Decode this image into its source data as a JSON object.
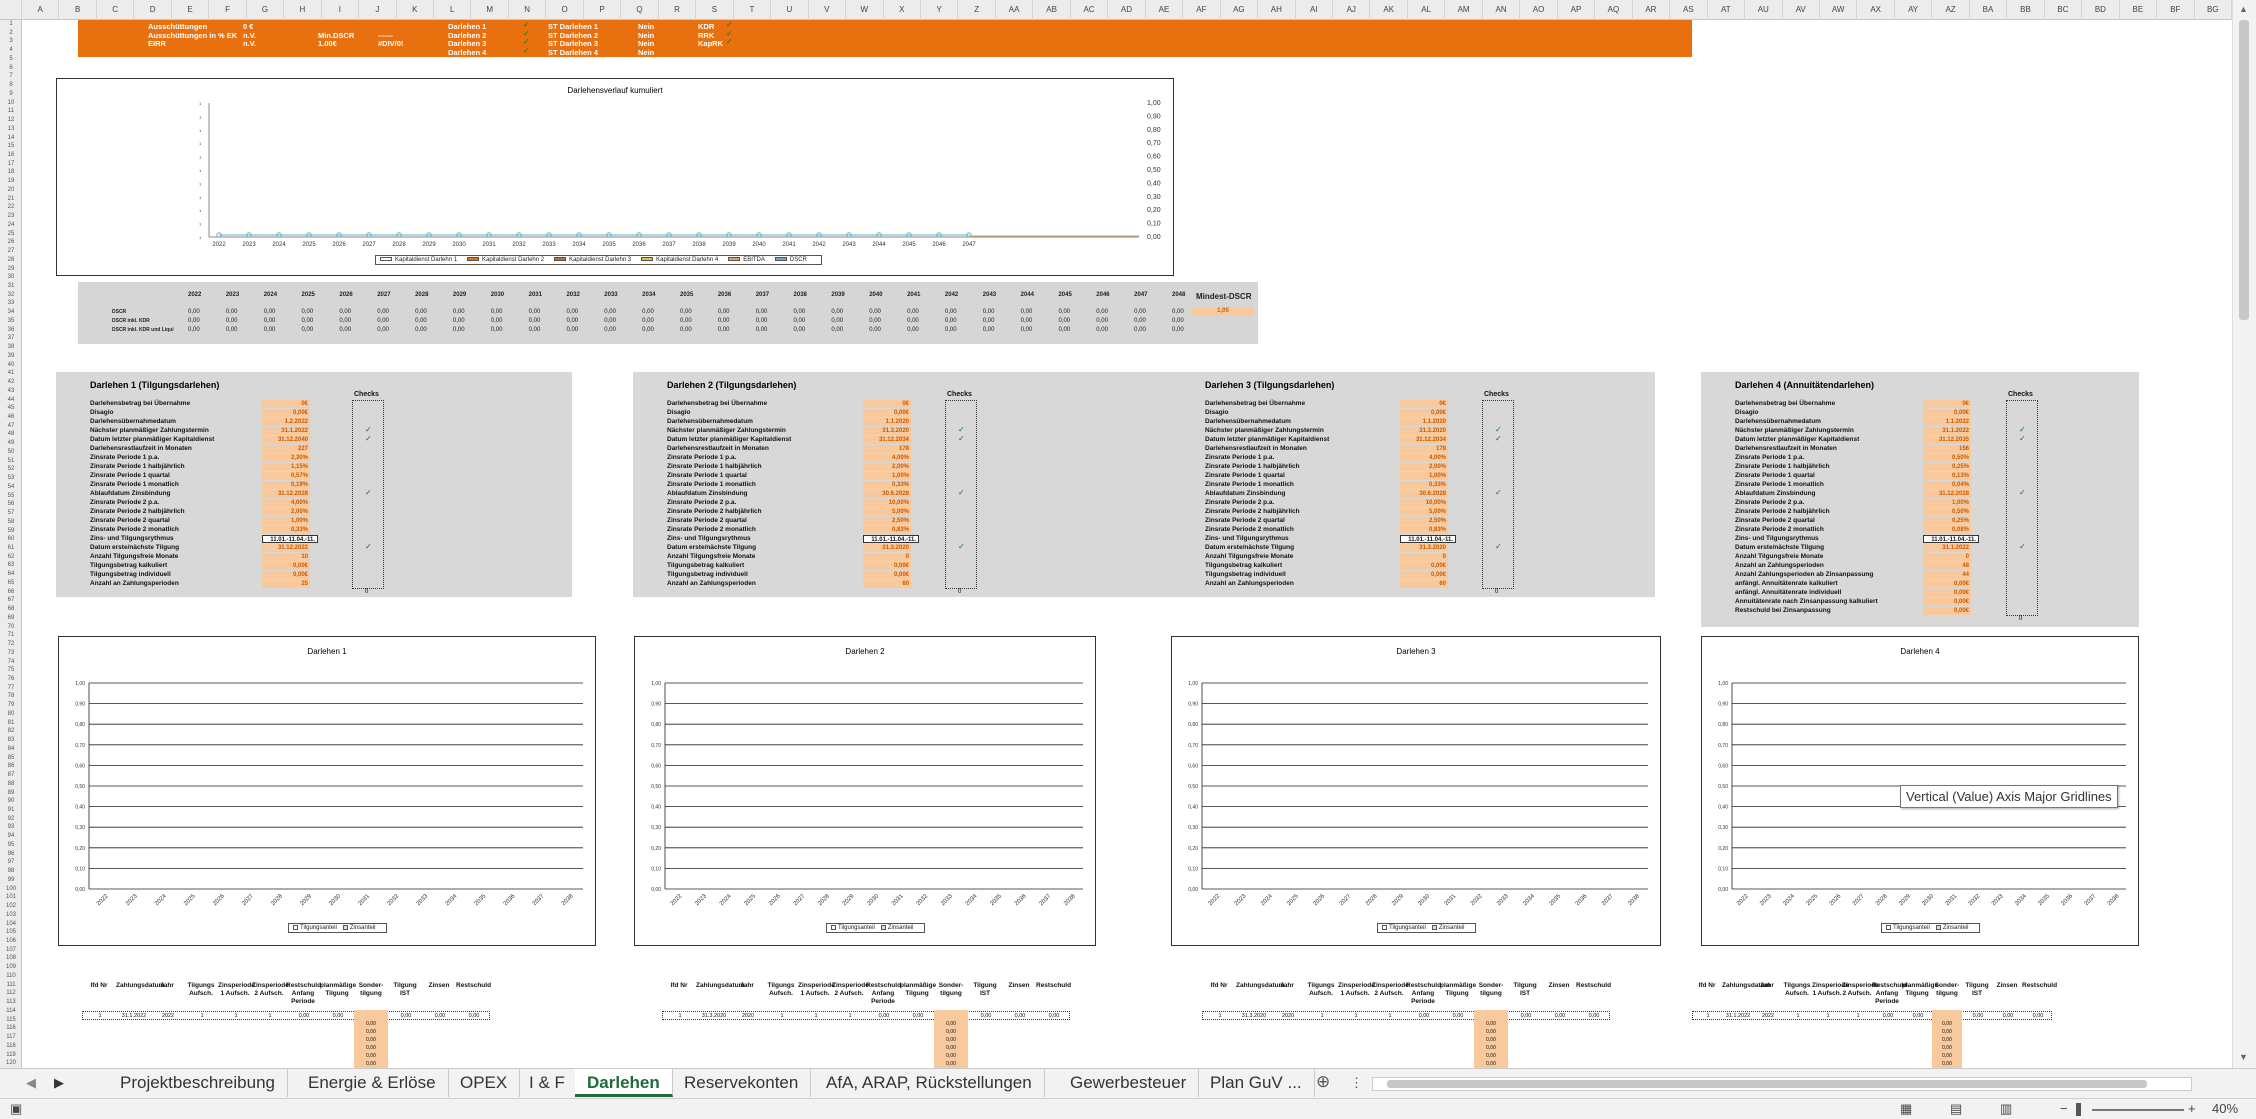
{
  "columns": [
    "A",
    "B",
    "C",
    "D",
    "E",
    "F",
    "G",
    "H",
    "I",
    "J",
    "K",
    "L",
    "M",
    "N",
    "O",
    "P",
    "Q",
    "R",
    "S",
    "T",
    "U",
    "V",
    "W",
    "X",
    "Y",
    "Z",
    "AA",
    "AB",
    "AC",
    "AD",
    "AE",
    "AF",
    "AG",
    "AH",
    "AI",
    "AJ",
    "AK",
    "AL",
    "AM",
    "AN",
    "AO",
    "AP",
    "AQ",
    "AR",
    "AS",
    "AT",
    "AU",
    "AV",
    "AW",
    "AX",
    "AY",
    "AZ",
    "BA",
    "BB",
    "BC",
    "BD",
    "BE",
    "BF",
    "BG"
  ],
  "header": {
    "r1": [
      "Ausschüttungen",
      "0 €",
      "Darlehen 1",
      "ST Darlehen 1",
      "Nein",
      "KDR"
    ],
    "r2": [
      "Ausschüttungen in % EK",
      "n.V.",
      "Min.DSCR",
      "------",
      "Darlehen 2",
      "ST Darlehen 2",
      "Nein",
      "RRK"
    ],
    "r3": [
      "EIRR",
      "n.V.",
      "1.00€",
      "#DIV/0!",
      "Darlehen 3",
      "ST Darlehen 3",
      "Nein",
      "KapRK"
    ],
    "r4": [
      "Darlehen 4",
      "ST Darlehen 4",
      "Nein"
    ]
  },
  "top_chart": {
    "title": "Darlehensverlauf kumuliert",
    "legend": [
      "Kapitaldienst Darlehn 1",
      "Kapitaldienst Darlehn 2",
      "Kapitaldienst Darlehn 3",
      "Kapitaldienst Darlehn 4",
      "EBITDA",
      "DSCR"
    ]
  },
  "chart_data": [
    {
      "type": "line",
      "title": "Darlehensverlauf kumuliert",
      "x": [
        "2022",
        "2023",
        "2024",
        "2025",
        "2026",
        "2027",
        "2028",
        "2029",
        "2030",
        "2031",
        "2032",
        "2033",
        "2034",
        "2035",
        "2036",
        "2037",
        "2038",
        "2039",
        "2040",
        "2041",
        "2042",
        "2043",
        "2044",
        "2045",
        "2046",
        "2047"
      ],
      "series": [
        {
          "name": "Kapitaldienst Darlehn 1",
          "values": [
            0,
            0,
            0,
            0,
            0,
            0,
            0,
            0,
            0,
            0,
            0,
            0,
            0,
            0,
            0,
            0,
            0,
            0,
            0,
            0,
            0,
            0,
            0,
            0,
            0,
            0
          ]
        },
        {
          "name": "Kapitaldienst Darlehn 2",
          "values": [
            0,
            0,
            0,
            0,
            0,
            0,
            0,
            0,
            0,
            0,
            0,
            0,
            0,
            0,
            0,
            0,
            0,
            0,
            0,
            0,
            0,
            0,
            0,
            0,
            0,
            0
          ]
        },
        {
          "name": "Kapitaldienst Darlehn 3",
          "values": [
            0,
            0,
            0,
            0,
            0,
            0,
            0,
            0,
            0,
            0,
            0,
            0,
            0,
            0,
            0,
            0,
            0,
            0,
            0,
            0,
            0,
            0,
            0,
            0,
            0,
            0
          ]
        },
        {
          "name": "Kapitaldienst Darlehn 4",
          "values": [
            0,
            0,
            0,
            0,
            0,
            0,
            0,
            0,
            0,
            0,
            0,
            0,
            0,
            0,
            0,
            0,
            0,
            0,
            0,
            0,
            0,
            0,
            0,
            0,
            0,
            0
          ]
        },
        {
          "name": "EBITDA",
          "values": [
            0,
            0,
            0,
            0,
            0,
            0,
            0,
            0,
            0,
            0,
            0,
            0,
            0,
            0,
            0,
            0,
            0,
            0,
            0,
            0,
            0,
            0,
            0,
            0,
            0,
            0
          ]
        },
        {
          "name": "DSCR",
          "values": [
            0,
            0,
            0,
            0,
            0,
            0,
            0,
            0,
            0,
            0,
            0,
            0,
            0,
            0,
            0,
            0,
            0,
            0,
            0,
            0,
            0,
            0,
            0,
            0,
            0,
            0
          ]
        }
      ],
      "ylim": [
        0,
        1
      ],
      "y2lim": [
        0,
        1
      ],
      "y2ticks": [
        "0,00",
        "0,10",
        "0,20",
        "0,30",
        "0,40",
        "0,50",
        "0,60",
        "0,70",
        "0,80",
        "0,90",
        "1,00"
      ]
    },
    {
      "type": "bar",
      "title": "Darlehen 1",
      "x": [
        "2022",
        "2023",
        "2024",
        "2025",
        "2026",
        "2027",
        "2028",
        "2029",
        "2030",
        "2031",
        "2032",
        "2033",
        "2034",
        "2035",
        "2036",
        "2037",
        "2038"
      ],
      "series": [
        {
          "name": "Tilgungsanteil",
          "values": []
        },
        {
          "name": "Zinsanteil",
          "values": []
        }
      ],
      "ylim": [
        0,
        1
      ]
    },
    {
      "type": "bar",
      "title": "Darlehen 2",
      "x": [
        "2022",
        "2023",
        "2024",
        "2025",
        "2026",
        "2027",
        "2028",
        "2029",
        "2030",
        "2031",
        "2032",
        "2033",
        "2034",
        "2035",
        "2036",
        "2037",
        "2038"
      ],
      "series": [
        {
          "name": "Tilgungsanteil",
          "values": []
        },
        {
          "name": "Zinsanteil",
          "values": []
        }
      ],
      "ylim": [
        0,
        1
      ]
    },
    {
      "type": "bar",
      "title": "Darlehen 3",
      "x": [
        "2022",
        "2023",
        "2024",
        "2025",
        "2026",
        "2027",
        "2028",
        "2029",
        "2030",
        "2031",
        "2032",
        "2033",
        "2034",
        "2035",
        "2036",
        "2037",
        "2038"
      ],
      "series": [
        {
          "name": "Tilgungsanteil",
          "values": []
        },
        {
          "name": "Zinsanteil",
          "values": []
        }
      ],
      "ylim": [
        0,
        1
      ]
    },
    {
      "type": "bar",
      "title": "Darlehen 4",
      "x": [
        "2022",
        "2023",
        "2024",
        "2025",
        "2026",
        "2027",
        "2028",
        "2029",
        "2030",
        "2031",
        "2032",
        "2033",
        "2034",
        "2035",
        "2036",
        "2037",
        "2038"
      ],
      "series": [
        {
          "name": "Tilgungsanteil",
          "values": []
        },
        {
          "name": "Zinsanteil",
          "values": []
        }
      ],
      "ylim": [
        0,
        1
      ]
    }
  ],
  "small_yticks": [
    "0,00",
    "0,10",
    "0,20",
    "0,30",
    "0,40",
    "0,50",
    "0,60",
    "0,70",
    "0,80",
    "0,90",
    "1,00"
  ],
  "dscr": {
    "years": [
      "2022",
      "2023",
      "2024",
      "2025",
      "2026",
      "2027",
      "2028",
      "2029",
      "2030",
      "2031",
      "2032",
      "2033",
      "2034",
      "2035",
      "2036",
      "2037",
      "2038",
      "2039",
      "2040",
      "2041",
      "2042",
      "2043",
      "2044",
      "2045",
      "2046",
      "2047",
      "2048"
    ],
    "mindest_label": "Mindest-DSCR",
    "mindest_value": "1,05",
    "rows": [
      "DSCR",
      "DSCR inkl. KDR",
      "DSCR inkl. KDR und Liqui"
    ],
    "cell": "0,00"
  },
  "loans": [
    {
      "title": "Darlehen 1 (Tilgungsdarlehen)",
      "labels": [
        "Darlehensbetrag bei Übernahme",
        "Disagio",
        "Darlehensübernahmedatum",
        "Nächster planmäßiger Zahlungstermin",
        "Datum letzter planmäßiger Kapitaldienst",
        "Darlehensrestlaufzeit in Monaten",
        "Zinsrate Periode 1 p.a.",
        "Zinsrate Periode 1 halbjährlich",
        "Zinsrate Periode 1 quartal",
        "Zinsrate Periode 1 monatlich",
        "Ablaufdatum Zinsbindung",
        "Zinsrate Periode 2 p.a.",
        "Zinsrate Periode 2 halbjährlich",
        "Zinsrate Periode 2 quartal",
        "Zinsrate Periode 2 monatlich",
        "Zins- und Tilgungsrythmus",
        "Datum erste/nächste Tilgung",
        "Anzahl Tilgungsfreie Monate",
        "Tilgungsbetrag kalkuliert",
        "Tilgungsbetrag individuell",
        "Anzahl an Zahlungsperioden"
      ],
      "values": [
        "0€",
        "0,00€",
        "1.2.2022",
        "31.1.2022",
        "31.12.2040",
        "227",
        "2,30%",
        "1,15%",
        "0,57%",
        "0,19%",
        "31.12.2028",
        "4,00%",
        "2,00%",
        "1,00%",
        "0,33%",
        "11.01.-11.04.-11.",
        "31.12.2022",
        "10",
        "0,00€",
        "0,00€",
        "25"
      ]
    },
    {
      "title": "Darlehen 2 (Tilgungsdarlehen)",
      "labels": [
        "Darlehensbetrag bei Übernahme",
        "Disagio",
        "Darlehensübernahmedatum",
        "Nächster planmäßiger Zahlungstermin",
        "Datum letzter planmäßiger Kapitaldienst",
        "Darlehensrestlaufzeit in Monaten",
        "Zinsrate Periode 1 p.a.",
        "Zinsrate Periode 1 halbjährlich",
        "Zinsrate Periode 1 quartal",
        "Zinsrate Periode 1 monatlich",
        "Ablaufdatum Zinsbindung",
        "Zinsrate Periode 2 p.a.",
        "Zinsrate Periode 2 halbjährlich",
        "Zinsrate Periode 2 quartal",
        "Zinsrate Periode 2 monatlich",
        "Zins- und Tilgungsrythmus",
        "Datum erste/nächste Tilgung",
        "Anzahl Tilgungsfreie Monate",
        "Tilgungsbetrag kalkuliert",
        "Tilgungsbetrag individuell",
        "Anzahl an Zahlungsperioden"
      ],
      "values": [
        "0€",
        "0,00€",
        "1.1.2020",
        "31.3.2020",
        "31.12.2034",
        "178",
        "4,00%",
        "2,00%",
        "1,00%",
        "0,33%",
        "30.6.2028",
        "10,00%",
        "5,00%",
        "2,50%",
        "0,83%",
        "11.01.-11.04.-11.",
        "31.3.2020",
        "0",
        "0,00€",
        "0,00€",
        "60"
      ]
    },
    {
      "title": "Darlehen 3 (Tilgungsdarlehen)",
      "labels": [
        "Darlehensbetrag bei Übernahme",
        "Disagio",
        "Darlehensübernahmedatum",
        "Nächster planmäßiger Zahlungstermin",
        "Datum letzter planmäßiger Kapitaldienst",
        "Darlehensrestlaufzeit in Monaten",
        "Zinsrate Periode 1 p.a.",
        "Zinsrate Periode 1 halbjährlich",
        "Zinsrate Periode 1 quartal",
        "Zinsrate Periode 1 monatlich",
        "Ablaufdatum Zinsbindung",
        "Zinsrate Periode 2 p.a.",
        "Zinsrate Periode 2 halbjährlich",
        "Zinsrate Periode 2 quartal",
        "Zinsrate Periode 2 monatlich",
        "Zins- und Tilgungsrythmus",
        "Datum erste/nächste Tilgung",
        "Anzahl Tilgungsfreie Monate",
        "Tilgungsbetrag kalkuliert",
        "Tilgungsbetrag individuell",
        "Anzahl an Zahlungsperioden"
      ],
      "values": [
        "0€",
        "0,00€",
        "1.1.2020",
        "31.3.2020",
        "31.12.2034",
        "178",
        "4,00%",
        "2,00%",
        "1,00%",
        "0,33%",
        "30.6.2028",
        "10,00%",
        "5,00%",
        "2,50%",
        "0,83%",
        "11.01.-11.04.-11.",
        "31.3.2020",
        "0",
        "0,00€",
        "0,00€",
        "60"
      ]
    },
    {
      "title": "Darlehen 4 (Annuitätendarlehen)",
      "labels": [
        "Darlehensbetrag bei Übernahme",
        "Disagio",
        "Darlehensübernahmedatum",
        "Nächster planmäßiger Zahlungstermin",
        "Datum letzter planmäßiger Kapitaldienst",
        "Darlehensrestlaufzeit in Monaten",
        "Zinsrate Periode 1 p.a.",
        "Zinsrate Periode 1 halbjährlich",
        "Zinsrate Periode 1 quartal",
        "Zinsrate Periode 1 monatlich",
        "Ablaufdatum Zinsbindung",
        "Zinsrate Periode 2 p.a.",
        "Zinsrate Periode 2 halbjährlich",
        "Zinsrate Periode 2 quartal",
        "Zinsrate Periode 2 monatlich",
        "Zins- und Tilgungsrythmus",
        "Datum erste/nächste Tilgung",
        "Anzahl Tilgungsfreie Monate",
        "Anzahl an Zahlungsperioden",
        "Anzahl Zahlungsperioden ab Zinsanpassung",
        "anfängl. Annuitätenrate kalkuliert",
        "anfängl. Annuitätenrate individuell",
        "Annuitätenrate nach Zinsanpassung kalkuliert",
        "Restschuld bei Zinsanpassung"
      ],
      "values": [
        "0€",
        "0,00€",
        "1.1.2022",
        "31.1.2022",
        "31.12.2035",
        "156",
        "0,50%",
        "0,25%",
        "0,13%",
        "0,04%",
        "31.12.2028",
        "1,00%",
        "0,50%",
        "0,25%",
        "0,08%",
        "11.01.-11.04.-11.",
        "31.1.2022",
        "0",
        "48",
        "44",
        "0,00€",
        "0,00€",
        "0,00€",
        "0,00€"
      ]
    }
  ],
  "check_label": "Checks",
  "check_total": "0",
  "check_mark": "ok",
  "chart_legend": [
    "Tilgungsanteil",
    "Zinsanteil"
  ],
  "loan_tables": [
    {
      "headers": [
        "lfd Nr",
        "Zahlungsdatum",
        "Jahr",
        "Tilgungs Aufsch.",
        "Zinsperiode 1 Aufsch.",
        "Zinsperiode 2 Aufsch.",
        "Restschuld Anfang Periode",
        "planmäßige Tilgung",
        "Sonder-tilgung",
        "Tilgung IST",
        "Zinsen",
        "Restschuld"
      ],
      "row": [
        "1",
        "31.1.2022",
        "2022",
        "1",
        "1",
        "1",
        "0,00",
        "0,00",
        "0,00",
        "0,00",
        "0,00",
        "0,00"
      ]
    },
    {
      "headers": [
        "lfd Nr",
        "Zahlungsdatum",
        "Jahr",
        "Tilgungs Aufsch.",
        "Zinsperiode 1 Aufsch.",
        "Zinsperiode 2 Aufsch.",
        "Restschuld Anfang Periode",
        "planmäßige Tilgung",
        "Sonder-tilgung",
        "Tilgung IST",
        "Zinsen",
        "Restschuld"
      ],
      "row": [
        "1",
        "31.3.2020",
        "2020",
        "1",
        "1",
        "1",
        "0,00",
        "0,00",
        "0,00",
        "0,00",
        "0,00",
        "0,00"
      ]
    },
    {
      "headers": [
        "lfd Nr",
        "Zahlungsdatum",
        "Jahr",
        "Tilgungs Aufsch.",
        "Zinsperiode 1 Aufsch.",
        "Zinsperiode 2 Aufsch.",
        "Restschuld Anfang Periode",
        "planmäßige Tilgung",
        "Sonder-tilgung",
        "Tilgung IST",
        "Zinsen",
        "Restschuld"
      ],
      "row": [
        "1",
        "31.3.2020",
        "2020",
        "1",
        "1",
        "1",
        "0,00",
        "0,00",
        "0,00",
        "0,00",
        "0,00",
        "0,00"
      ]
    },
    {
      "headers": [
        "lfd Nr",
        "Zahlungsdatum",
        "Jahr",
        "Tilgungs Aufsch.",
        "Zinsperiode 1 Aufsch.",
        "Zinsperiode 2 Aufsch.",
        "Restschuld Anfang Periode",
        "planmäßige Tilgung",
        "Sonder-tilgung",
        "Tilgung IST",
        "Zinsen",
        "Restschuld"
      ],
      "row": [
        "1",
        "31.1.2022",
        "2022",
        "1",
        "1",
        "1",
        "0,00",
        "0,00",
        "0,00",
        "0,00",
        "0,00",
        "0,00"
      ]
    }
  ],
  "tooltip": "Vertical (Value) Axis Major Gridlines",
  "tabs": [
    "Projektbeschreibung",
    "Energie & Erlöse",
    "OPEX",
    "I & F",
    "Darlehen",
    "Reservekonten",
    "AfA, ARAP, Rückstellungen",
    "Gewerbesteuer",
    "Plan GuV ..."
  ],
  "active_tab": "Darlehen",
  "zoom": "40%",
  "colors": {
    "orange": "#e8700f",
    "light_orange": "#f9c99e",
    "accent": "#1e6b3a"
  }
}
